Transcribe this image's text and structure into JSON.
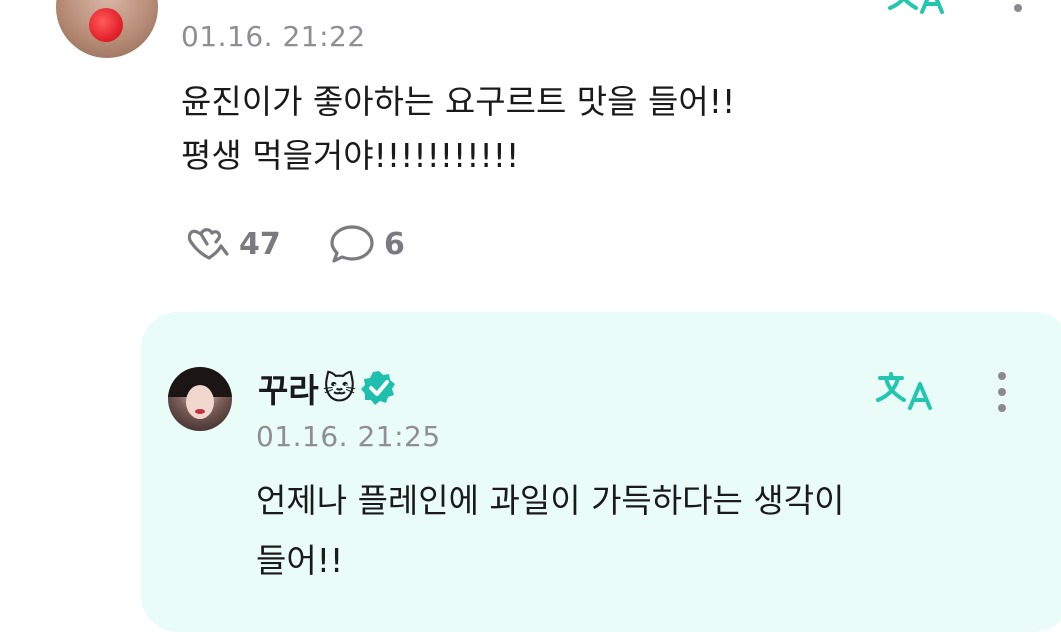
{
  "colors": {
    "accent": "#23c7b0",
    "reply_background": "#eafcf8",
    "timestamp": "#8e8e93",
    "action_text": "#7a7a80",
    "verified_badge": "#1fbfae"
  },
  "comment": {
    "timestamp": "01.16. 21:22",
    "lines": [
      "윤진이가 좋아하는 요구르트 맛을 들어!!",
      "평생 먹을거야!!!!!!!!!!!"
    ],
    "actions": {
      "like_icon": "heart-hands-icon",
      "like_count": "47",
      "reply_icon": "speech-bubble-icon",
      "reply_count": "6"
    }
  },
  "reply": {
    "author_name": "꾸라",
    "author_emoji": "🐱",
    "verified_icon": "verified-badge-icon",
    "translate_icon": "translate-icon",
    "more_icon": "more-vertical-icon",
    "timestamp": "01.16. 21:25",
    "lines": [
      "언제나 플레인에 과일이 가득하다는 생각이",
      "들어!!"
    ]
  }
}
